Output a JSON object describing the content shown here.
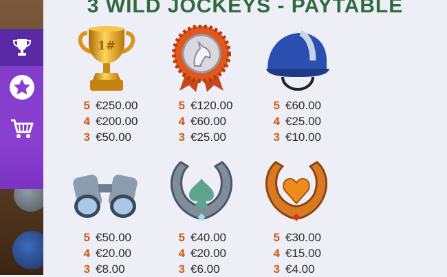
{
  "title": "3 WILD JOCKEYS - PAYTABLE",
  "sidebar": {
    "items": [
      {
        "name": "paytable",
        "icon": "trophy-icon",
        "active": true
      },
      {
        "name": "features",
        "icon": "star-icon",
        "active": false
      },
      {
        "name": "buy",
        "icon": "cart-icon",
        "active": false
      }
    ]
  },
  "symbols": [
    {
      "icon": "trophy-icon",
      "pays": [
        {
          "count": "5",
          "amount": "€250.00"
        },
        {
          "count": "4",
          "amount": "€200.00"
        },
        {
          "count": "3",
          "amount": "€50.00"
        }
      ]
    },
    {
      "icon": "horse-medal-icon",
      "pays": [
        {
          "count": "5",
          "amount": "€120.00"
        },
        {
          "count": "4",
          "amount": "€60.00"
        },
        {
          "count": "3",
          "amount": "€25.00"
        }
      ]
    },
    {
      "icon": "jockey-helmet-icon",
      "pays": [
        {
          "count": "5",
          "amount": "€60.00"
        },
        {
          "count": "4",
          "amount": "€25.00"
        },
        {
          "count": "3",
          "amount": "€10.00"
        }
      ]
    },
    {
      "icon": "binoculars-icon",
      "pays": [
        {
          "count": "5",
          "amount": "€50.00"
        },
        {
          "count": "4",
          "amount": "€20.00"
        },
        {
          "count": "3",
          "amount": "€8.00"
        }
      ]
    },
    {
      "icon": "horseshoe-spade-icon",
      "pays": [
        {
          "count": "5",
          "amount": "€40.00"
        },
        {
          "count": "4",
          "amount": "€20.00"
        },
        {
          "count": "3",
          "amount": "€6.00"
        }
      ]
    },
    {
      "icon": "horseshoe-heart-icon",
      "pays": [
        {
          "count": "5",
          "amount": "€30.00"
        },
        {
          "count": "4",
          "amount": "€15.00"
        },
        {
          "count": "3",
          "amount": "€4.00"
        }
      ]
    }
  ],
  "colors": {
    "title": "#2f6b3c",
    "count": "#d45b10",
    "sidebar": "#8a3fd0",
    "panel": "#eeeef7"
  }
}
